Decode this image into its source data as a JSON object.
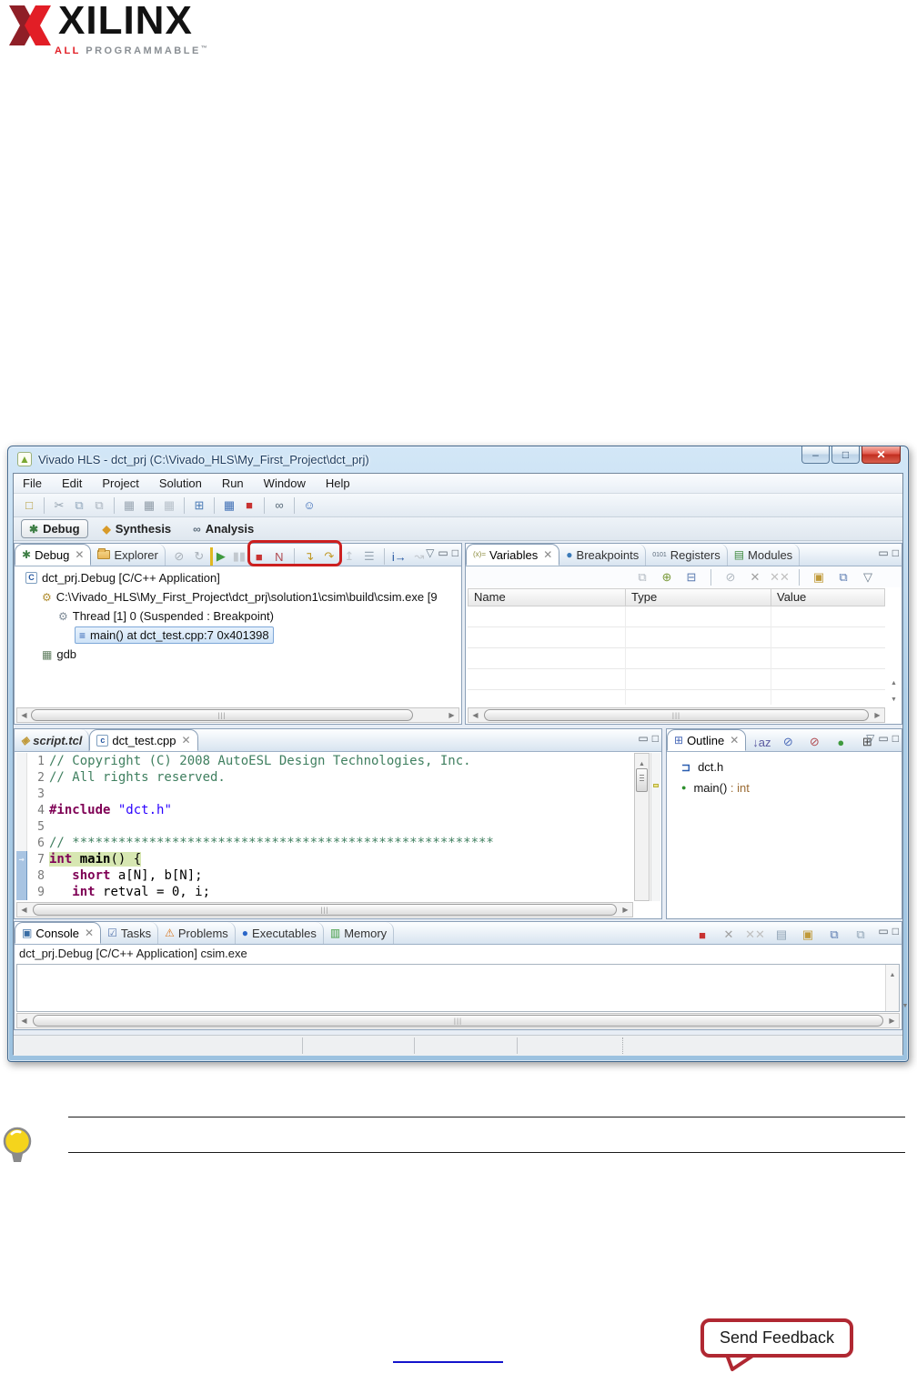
{
  "logo": {
    "brand": "XILINX",
    "tagline_red": "ALL",
    "tagline_rest": " PROGRAMMABLE",
    "tm": "™"
  },
  "footer": {
    "send_feedback": "Send Feedback"
  },
  "icons": {
    "app": {
      "g": "▲",
      "c": "#7aa832"
    },
    "win-min": {
      "g": "–",
      "c": "#33506e"
    },
    "win-max": {
      "g": "□",
      "c": "#33506e"
    },
    "win-close": {
      "g": "✕",
      "c": "#ffffff"
    },
    "view-menu": {
      "g": "▽",
      "c": "#6a7a8a"
    },
    "minimize": {
      "g": "▭",
      "c": "#55606b"
    },
    "maximize": {
      "g": "□",
      "c": "#55606b"
    },
    "close": {
      "g": "✕",
      "c": "#8a8a8a"
    },
    "bug": {
      "g": "✱",
      "c": "#3f7f46"
    },
    "synthesis": {
      "g": "◆",
      "c": "#d89a28"
    },
    "analysis": {
      "g": "∞",
      "c": "#5a6b7a"
    },
    "vars": {
      "g": "(x)=",
      "c": "#8a8a3a",
      "s": "8px"
    },
    "breakpoints": {
      "g": "●",
      "c": "#3a7ab8"
    },
    "registers": {
      "g": "0101",
      "c": "#5a6a7a",
      "s": "7px"
    },
    "modules": {
      "g": "▤",
      "c": "#3f8a3f"
    },
    "outline": {
      "g": "⊞",
      "c": "#4a6ab8"
    },
    "console": {
      "g": "▣",
      "c": "#3a6ea5"
    },
    "tasks": {
      "g": "☑",
      "c": "#5a7ab0"
    },
    "problems": {
      "g": "⚠",
      "c": "#d8761f"
    },
    "executables": {
      "g": "●",
      "c": "#2a66c8"
    },
    "memory": {
      "g": "▥",
      "c": "#3f9a3f"
    },
    "script": {
      "g": "◈",
      "c": "#c09a3a"
    },
    "cfile": {
      "g": "c",
      "c": "#2456a0"
    },
    "capp": {
      "g": "C",
      "c": "#2456a0"
    },
    "process": {
      "g": "⚙",
      "c": "#b08d2f"
    },
    "thread": {
      "g": "⚙",
      "c": "#7d8a96"
    },
    "frame": {
      "g": "≡",
      "c": "#2a5db0"
    },
    "gdb": {
      "g": "▦",
      "c": "#5f7d5f"
    },
    "include": {
      "g": "⊐",
      "c": "#2a5db0"
    },
    "method-public": {
      "g": "●",
      "c": "#2d8f2d"
    },
    "instr-pointer": {
      "g": "→",
      "c": "#1c4f8a"
    },
    "up-arrow": {
      "g": "▲",
      "c": "#7a7a7a",
      "s": "7px"
    },
    "down-arrow": {
      "g": "▼",
      "c": "#7a7a7a",
      "s": "7px"
    },
    "left-arrow": {
      "g": "◀",
      "c": "#7a7a7a",
      "s": "8px"
    },
    "right-arrow": {
      "g": "▶",
      "c": "#7a7a7a",
      "s": "8px"
    }
  },
  "window": {
    "title": "Vivado HLS - dct_prj (C:\\Vivado_HLS\\My_First_Project\\dct_prj)",
    "menu": [
      "File",
      "Edit",
      "Project",
      "Solution",
      "Run",
      "Window",
      "Help"
    ],
    "perspectives": [
      {
        "label": "Debug"
      },
      {
        "label": "Synthesis"
      },
      {
        "label": "Analysis"
      }
    ],
    "toolbars": {
      "main": [
        {
          "name": "new-file",
          "glyph": "□",
          "color": "#b59a3a"
        },
        {
          "name": "sep"
        },
        {
          "name": "cut",
          "glyph": "✂",
          "color": "#93a1ae"
        },
        {
          "name": "copy",
          "glyph": "⧉",
          "color": "#8fa5ba"
        },
        {
          "name": "paste",
          "glyph": "⧉",
          "color": "#a8b2bd"
        },
        {
          "name": "sep"
        },
        {
          "name": "save",
          "glyph": "▦",
          "color": "#9aa6b2"
        },
        {
          "name": "save-all",
          "glyph": "▦",
          "color": "#8e9aa6"
        },
        {
          "name": "save-as",
          "glyph": "▦",
          "color": "#b8c1ca"
        },
        {
          "name": "sep"
        },
        {
          "name": "project-settings",
          "glyph": "⊞",
          "color": "#4a7ab5"
        },
        {
          "name": "sep"
        },
        {
          "name": "run-c-simulation",
          "glyph": "▦",
          "color": "#3f6fb5"
        },
        {
          "name": "stop",
          "glyph": "■",
          "color": "#c83232"
        },
        {
          "name": "sep"
        },
        {
          "name": "analysis-glasses",
          "glyph": "∞",
          "color": "#5a6b7a"
        },
        {
          "name": "sep"
        },
        {
          "name": "feedback",
          "glyph": "☺",
          "color": "#3a6ab8"
        }
      ],
      "debug": [
        {
          "name": "skip-all-breakpoints",
          "glyph": "⊘",
          "color": "#a8b0b8"
        },
        {
          "name": "resume-without-signal",
          "glyph": "↻",
          "color": "#a8b0b8"
        },
        {
          "name": "resume",
          "glyph": "▶",
          "color": "#3f9a3f",
          "cls": "resume-ic"
        },
        {
          "name": "suspend",
          "glyph": "▮▮",
          "color": "#c2c8ce"
        },
        {
          "name": "terminate",
          "glyph": "■",
          "color": "#c83232"
        },
        {
          "name": "disconnect",
          "glyph": "N",
          "color": "#b04a50"
        },
        {
          "name": "sep"
        },
        {
          "name": "step-into",
          "glyph": "↴",
          "color": "#c09a28"
        },
        {
          "name": "step-over",
          "glyph": "↷",
          "color": "#c09a28"
        },
        {
          "name": "step-return",
          "glyph": "↥",
          "color": "#c2c8ce"
        },
        {
          "name": "drop-to-frame",
          "glyph": "☰",
          "color": "#9aa8b5"
        },
        {
          "name": "sep"
        },
        {
          "name": "instruction-stepping",
          "glyph": "i→",
          "color": "#2456a0"
        },
        {
          "name": "use-step-filters",
          "glyph": "↝",
          "color": "#c2c8ce"
        }
      ],
      "variables": [
        {
          "name": "show-logical-structure",
          "glyph": "⧉",
          "color": "#b0b8c0"
        },
        {
          "name": "add-watch",
          "glyph": "⊕",
          "color": "#7a9a3a"
        },
        {
          "name": "collapse-all",
          "glyph": "⊟",
          "color": "#5a7ab0"
        },
        {
          "name": "sep"
        },
        {
          "name": "disable-selected",
          "glyph": "⊘",
          "color": "#b0b8c0"
        },
        {
          "name": "remove-selected",
          "glyph": "✕",
          "color": "#a0a0a0"
        },
        {
          "name": "remove-all",
          "glyph": "✕✕",
          "color": "#c0c0c0"
        },
        {
          "name": "sep"
        },
        {
          "name": "new-view",
          "glyph": "▣",
          "color": "#c09a3a"
        },
        {
          "name": "pin-view",
          "glyph": "⧉",
          "color": "#5a7ab0"
        },
        {
          "name": "view-menu",
          "glyph": "▽",
          "color": "#6a7a8a"
        }
      ],
      "outline": [
        {
          "name": "sort",
          "glyph": "↓az",
          "color": "#5a5aa0"
        },
        {
          "name": "hide-fields",
          "glyph": "⊘",
          "color": "#4a6ab8"
        },
        {
          "name": "hide-static",
          "glyph": "⊘",
          "color": "#b04a50"
        },
        {
          "name": "hide-non-public",
          "glyph": "●",
          "color": "#3f9a3f"
        },
        {
          "name": "filters",
          "glyph": "⊞",
          "color": "#444444"
        }
      ],
      "console": [
        {
          "name": "terminate",
          "glyph": "■",
          "color": "#c83232"
        },
        {
          "name": "remove-launch",
          "glyph": "✕",
          "color": "#a0a0a0"
        },
        {
          "name": "remove-all-terminated",
          "glyph": "✕✕",
          "color": "#c0c0c0"
        },
        {
          "name": "clear-console",
          "glyph": "▤",
          "color": "#8fa3b5"
        },
        {
          "name": "scroll-lock",
          "glyph": "▣",
          "color": "#c09a3a"
        },
        {
          "name": "pin-console",
          "glyph": "⧉",
          "color": "#5a7ab0"
        },
        {
          "name": "display-selected-console",
          "glyph": "⧉",
          "color": "#8fa3b5"
        }
      ]
    },
    "debug_panel": {
      "tabs": [
        "Debug",
        "Explorer"
      ],
      "tree": [
        {
          "icon": "capp",
          "label": "dct_prj.Debug [C/C++ Application]",
          "depth": 0
        },
        {
          "icon": "process",
          "label": "C:\\Vivado_HLS\\My_First_Project\\dct_prj\\solution1\\csim\\build\\csim.exe [9",
          "depth": 1
        },
        {
          "icon": "thread",
          "label": "Thread [1] 0 (Suspended : Breakpoint)",
          "depth": 2
        },
        {
          "icon": "frame",
          "label": "main() at dct_test.cpp:7 0x401398",
          "depth": 3,
          "selected": true
        },
        {
          "icon": "gdb",
          "label": "gdb",
          "depth": 1
        }
      ]
    },
    "variables_panel": {
      "tabs": [
        "Variables",
        "Breakpoints",
        "Registers",
        "Modules"
      ],
      "columns": [
        "Name",
        "Type",
        "Value"
      ]
    },
    "editor": {
      "tabs": [
        "script.tcl",
        "dct_test.cpp"
      ],
      "lines": [
        {
          "num": "1",
          "segments": [
            {
              "t": "// Copyright (C) 2008 AutoESL Design Technologies, Inc.",
              "c": "cm"
            }
          ]
        },
        {
          "num": "2",
          "segments": [
            {
              "t": "// All rights reserved.",
              "c": "cm"
            }
          ]
        },
        {
          "num": "3",
          "segments": []
        },
        {
          "num": "4",
          "segments": [
            {
              "t": "#include",
              "c": "kw"
            },
            {
              "t": " ",
              "c": "pl"
            },
            {
              "t": "\"dct.h\"",
              "c": "st"
            }
          ]
        },
        {
          "num": "5",
          "segments": []
        },
        {
          "num": "6",
          "segments": [
            {
              "t": "// *******************************************************",
              "c": "cm"
            }
          ]
        },
        {
          "num": "7",
          "current": true,
          "segments": [
            {
              "t": "int",
              "c": "kw"
            },
            {
              "t": " ",
              "c": "pl"
            },
            {
              "t": "main",
              "c": "fn"
            },
            {
              "t": "() {",
              "c": "pl"
            }
          ]
        },
        {
          "num": "8",
          "segments": [
            {
              "t": "   ",
              "c": "pl"
            },
            {
              "t": "short",
              "c": "kw"
            },
            {
              "t": " a[N], b[N];",
              "c": "pl"
            }
          ]
        },
        {
          "num": "9",
          "segments": [
            {
              "t": "   ",
              "c": "pl"
            },
            {
              "t": "int",
              "c": "kw"
            },
            {
              "t": " retval = 0, i;",
              "c": "pl"
            }
          ]
        }
      ]
    },
    "outline": {
      "tab": "Outline",
      "items": [
        {
          "icon": "include",
          "label": "dct.h",
          "type": ""
        },
        {
          "icon": "method-public",
          "label": "main()",
          "type": " : int"
        }
      ]
    },
    "console": {
      "tabs": [
        "Console",
        "Tasks",
        "Problems",
        "Executables",
        "Memory"
      ],
      "header": "dct_prj.Debug [C/C++ Application] csim.exe"
    }
  }
}
